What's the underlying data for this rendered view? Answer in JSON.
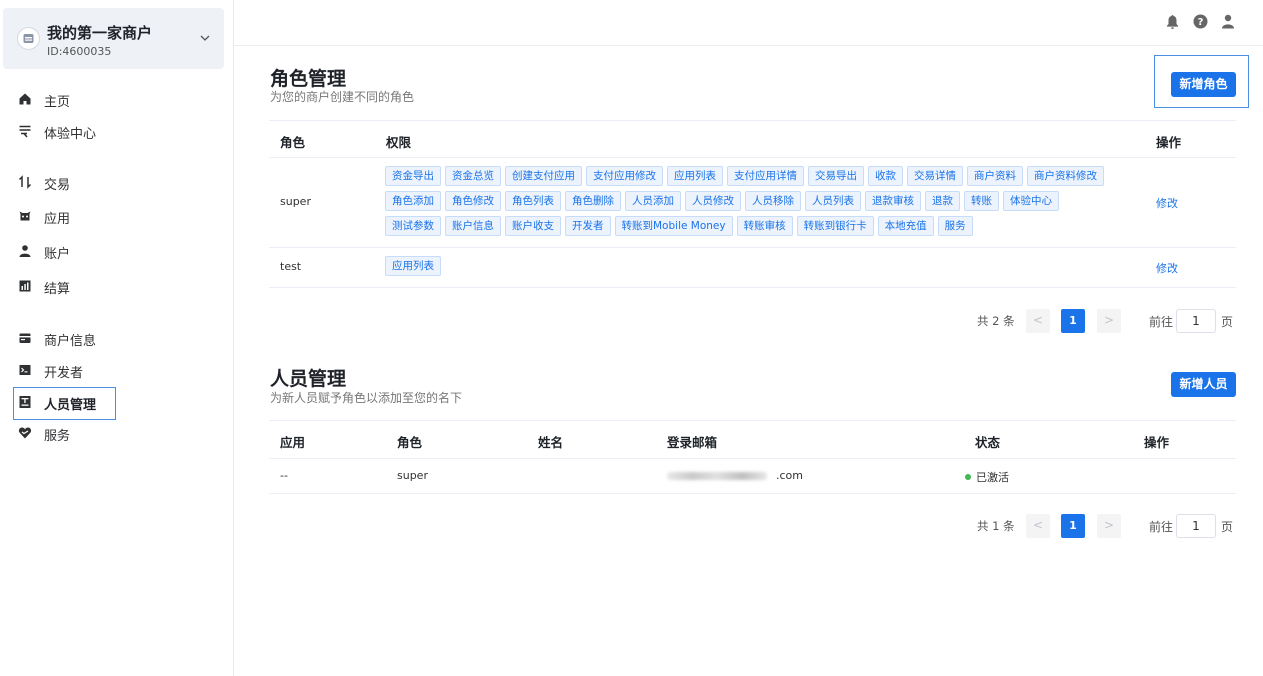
{
  "sidebar": {
    "merchant_name": "我的第一家商户",
    "merchant_id": "ID:4600035",
    "items": [
      {
        "label": "主页",
        "icon": "home-icon"
      },
      {
        "label": "体验中心",
        "icon": "experience-icon"
      },
      {
        "label": "交易",
        "icon": "transaction-icon"
      },
      {
        "label": "应用",
        "icon": "app-icon"
      },
      {
        "label": "账户",
        "icon": "account-icon"
      },
      {
        "label": "结算",
        "icon": "settlement-icon"
      },
      {
        "label": "商户信息",
        "icon": "merchant-info-icon"
      },
      {
        "label": "开发者",
        "icon": "developer-icon"
      },
      {
        "label": "人员管理",
        "icon": "staff-icon"
      },
      {
        "label": "服务",
        "icon": "service-icon"
      }
    ]
  },
  "topbar": {
    "icons": [
      "bell-icon",
      "help-icon",
      "user-icon"
    ]
  },
  "roles": {
    "title": "角色管理",
    "subtitle": "为您的商户创建不同的角色",
    "add_button": "新增角色",
    "columns": {
      "role": "角色",
      "perm": "权限",
      "op": "操作"
    },
    "rows": [
      {
        "role": "super",
        "perm_lines": [
          [
            "资金导出",
            "资金总览",
            "创建支付应用",
            "支付应用修改",
            "应用列表",
            "支付应用详情",
            "交易导出",
            "收款",
            "交易详情",
            "商户资料",
            "商户资料修改"
          ],
          [
            "角色添加",
            "角色修改",
            "角色列表",
            "角色删除",
            "人员添加",
            "人员修改",
            "人员移除",
            "人员列表",
            "退款审核",
            "退款",
            "转账",
            "体验中心"
          ],
          [
            "测试参数",
            "账户信息",
            "账户收支",
            "开发者",
            "转账到Mobile Money",
            "转账审核",
            "转账到银行卡",
            "本地充值",
            "服务"
          ]
        ],
        "action": "修改"
      },
      {
        "role": "test",
        "perm_lines": [
          [
            "应用列表"
          ]
        ],
        "action": "修改"
      }
    ],
    "pager": {
      "total": "共 2 条",
      "prev": "<",
      "current": "1",
      "next": ">",
      "goto": "前往",
      "page_value": "1",
      "page_suffix": "页"
    }
  },
  "staff": {
    "title": "人员管理",
    "subtitle": "为新人员赋予角色以添加至您的名下",
    "add_button": "新增人员",
    "columns": {
      "app": "应用",
      "role": "角色",
      "name": "姓名",
      "email": "登录邮箱",
      "status": "状态",
      "op": "操作"
    },
    "rows": [
      {
        "app": "--",
        "role": "super",
        "name": "",
        "email": ".com",
        "status": "已激活"
      }
    ],
    "pager": {
      "total": "共 1 条",
      "prev": "<",
      "current": "1",
      "next": ">",
      "goto": "前往",
      "page_value": "1",
      "page_suffix": "页"
    }
  },
  "colors": {
    "accent": "#1a73e8",
    "active": "#3fb950",
    "tag_bg": "#ecf3fd"
  }
}
